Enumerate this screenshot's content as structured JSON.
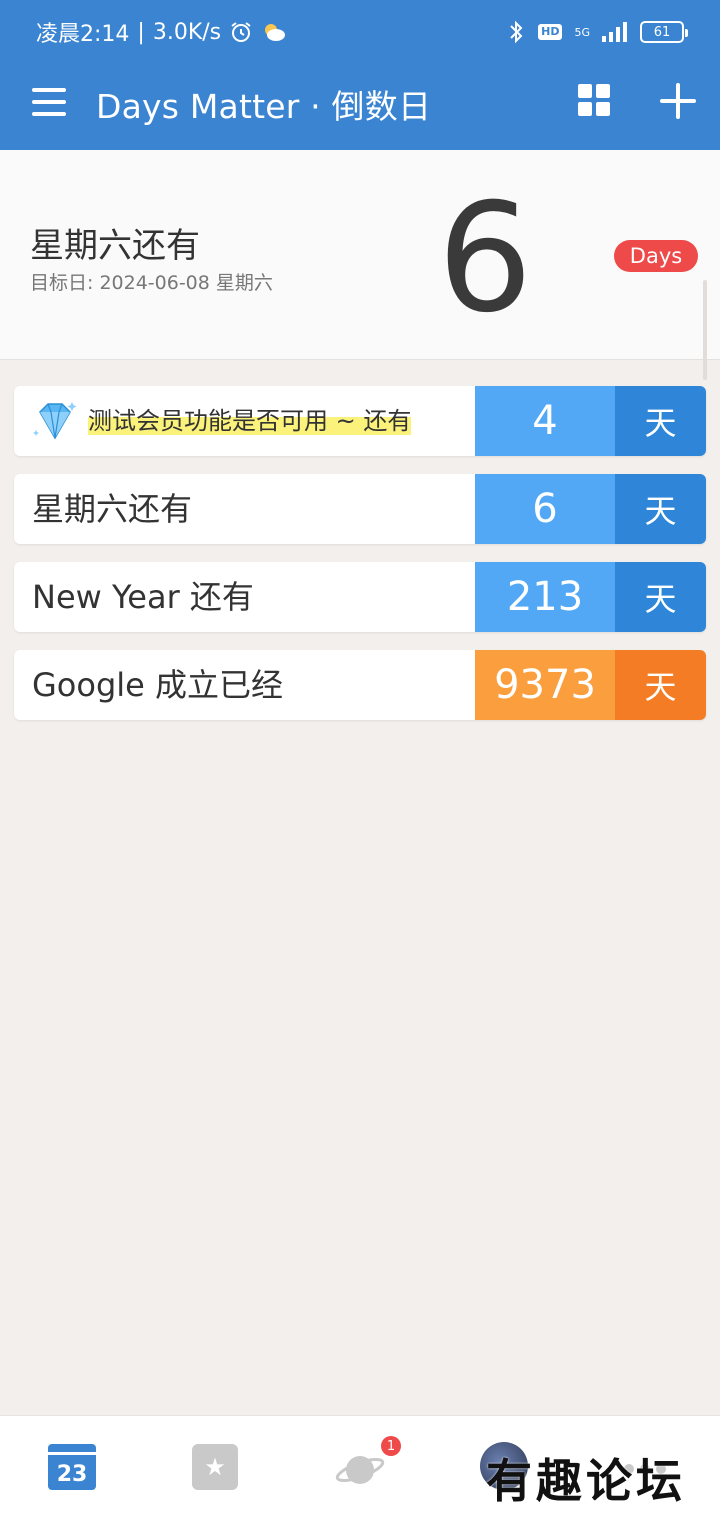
{
  "status_bar": {
    "time": "凌晨2:14",
    "speed": "3.0K/s",
    "network": "5G",
    "hd": "HD",
    "battery": "61"
  },
  "app_bar": {
    "title": "Days Matter · 倒数日"
  },
  "hero": {
    "title": "星期六还有",
    "target_date": "目标日: 2024-06-08 星期六",
    "number": "6",
    "badge": "Days"
  },
  "events": [
    {
      "label": "测试会员功能是否可用 ~ 还有",
      "count": "4",
      "unit": "天",
      "premium": true,
      "count_color": "#52a8f5",
      "unit_color": "#2f86d8"
    },
    {
      "label": "星期六还有",
      "count": "6",
      "unit": "天",
      "premium": false,
      "count_color": "#52a8f5",
      "unit_color": "#2f86d8"
    },
    {
      "label": "New Year 还有",
      "count": "213",
      "unit": "天",
      "premium": false,
      "count_color": "#52a8f5",
      "unit_color": "#2f86d8"
    },
    {
      "label": "Google 成立已经",
      "count": "9373",
      "unit": "天",
      "premium": false,
      "count_color": "#fa9e3e",
      "unit_color": "#f47c25"
    }
  ],
  "bottom_nav": {
    "calendar_day": "23",
    "planet_badge": "1"
  },
  "watermark": "有趣论坛",
  "colors": {
    "primary": "#3a84d1",
    "badge_red": "#ee4a4a",
    "background": "#f2efec"
  }
}
